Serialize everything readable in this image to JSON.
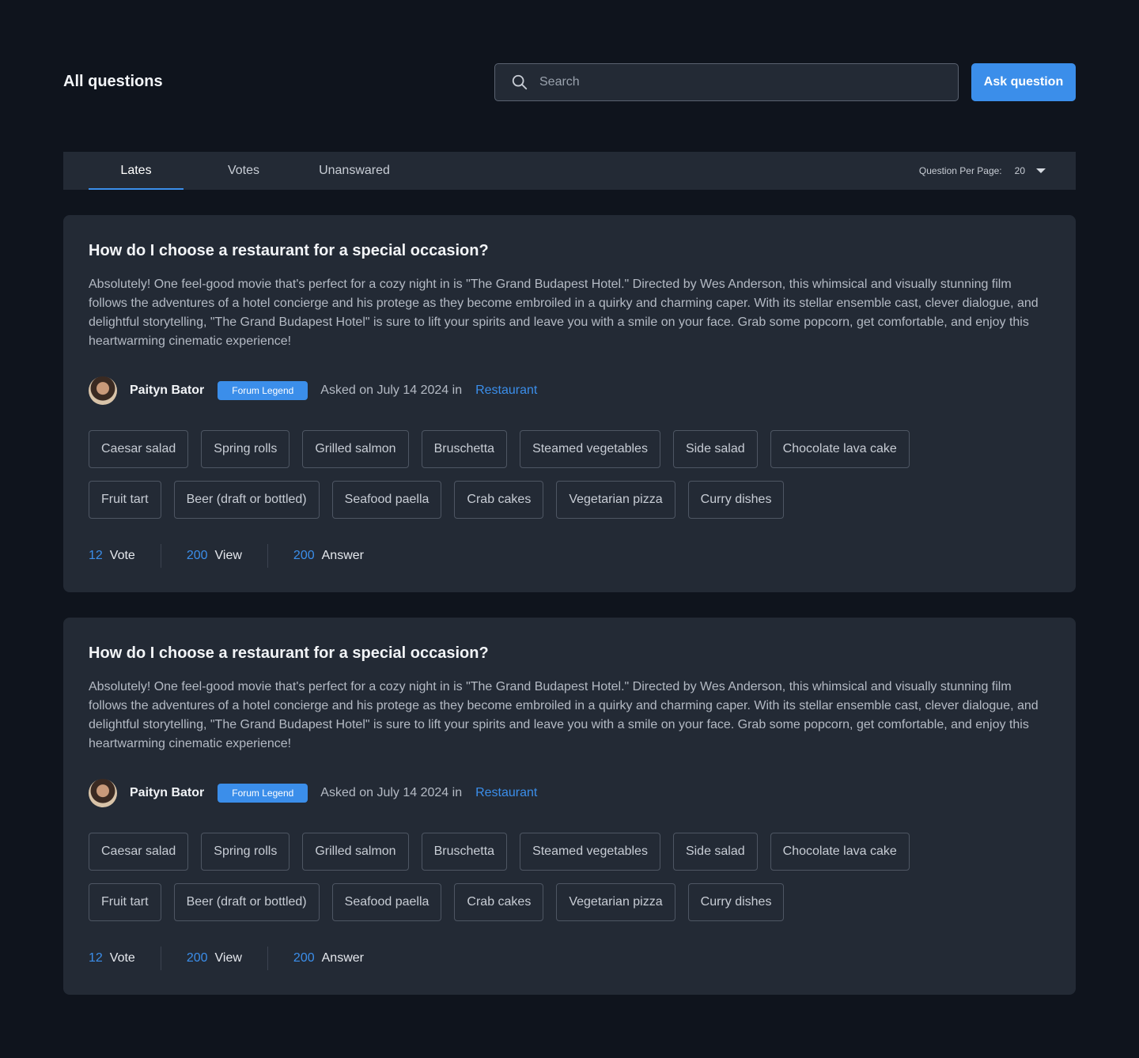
{
  "header": {
    "title": "All questions",
    "search_placeholder": "Search",
    "ask_button": "Ask question"
  },
  "tabs": {
    "items": [
      {
        "label": "Lates",
        "active": true
      },
      {
        "label": "Votes",
        "active": false
      },
      {
        "label": "Unanswared",
        "active": false
      }
    ],
    "per_page_label": "Question Per Page:",
    "per_page_value": "20"
  },
  "colors": {
    "accent": "#3b8eea",
    "background": "#0f141d",
    "card": "#232a35"
  },
  "questions": [
    {
      "title": "How do I choose a restaurant for a special occasion?",
      "body": "Absolutely! One feel-good movie that's perfect for a cozy night in is \"The Grand Budapest Hotel.\" Directed by Wes Anderson, this whimsical and visually stunning film follows the adventures of a hotel concierge and his protege as they become embroiled in a quirky and charming caper. With its stellar ensemble cast, clever dialogue, and delightful storytelling, \"The Grand Budapest Hotel\" is sure to lift your spirits and leave you with a smile on your face. Grab some popcorn, get comfortable, and enjoy this heartwarming cinematic experience!",
      "author": "Paityn Bator",
      "badge": "Forum Legend",
      "asked": "Asked on July 14 2024 in",
      "category": "Restaurant",
      "tags_row1": [
        "Caesar salad",
        "Spring rolls",
        "Grilled salmon",
        "Bruschetta",
        "Steamed vegetables",
        "Side salad",
        "Chocolate lava cake"
      ],
      "tags_row2": [
        "Fruit tart",
        "Beer (draft or bottled)",
        "Seafood paella",
        "Crab cakes",
        "Vegetarian pizza",
        "Curry dishes"
      ],
      "votes": "12",
      "vote_label": "Vote",
      "views": "200",
      "view_label": "View",
      "answers": "200",
      "answer_label": "Answer"
    },
    {
      "title": "How do I choose a restaurant for a special occasion?",
      "body": "Absolutely! One feel-good movie that's perfect for a cozy night in is \"The Grand Budapest Hotel.\" Directed by Wes Anderson, this whimsical and visually stunning film follows the adventures of a hotel concierge and his protege as they become embroiled in a quirky and charming caper. With its stellar ensemble cast, clever dialogue, and delightful storytelling, \"The Grand Budapest Hotel\" is sure to lift your spirits and leave you with a smile on your face. Grab some popcorn, get comfortable, and enjoy this heartwarming cinematic experience!",
      "author": "Paityn Bator",
      "badge": "Forum Legend",
      "asked": "Asked on July 14 2024 in",
      "category": "Restaurant",
      "tags_row1": [
        "Caesar salad",
        "Spring rolls",
        "Grilled salmon",
        "Bruschetta",
        "Steamed vegetables",
        "Side salad",
        "Chocolate lava cake"
      ],
      "tags_row2": [
        "Fruit tart",
        "Beer (draft or bottled)",
        "Seafood paella",
        "Crab cakes",
        "Vegetarian pizza",
        "Curry dishes"
      ],
      "votes": "12",
      "vote_label": "Vote",
      "views": "200",
      "view_label": "View",
      "answers": "200",
      "answer_label": "Answer"
    }
  ]
}
